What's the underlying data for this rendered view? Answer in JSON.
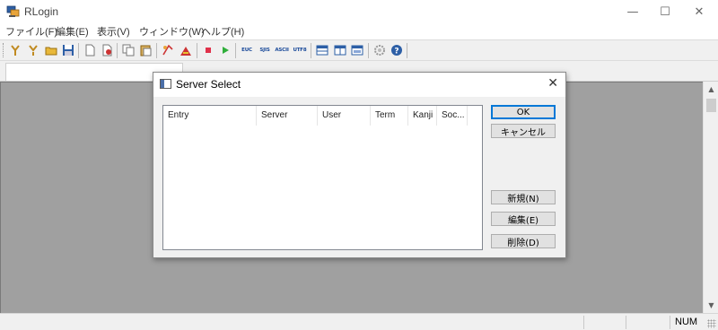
{
  "app": {
    "title": "RLogin"
  },
  "window_controls": {
    "minimize": "—",
    "maximize": "☐",
    "close": "✕"
  },
  "menu": [
    {
      "label": "ファイル(F)"
    },
    {
      "label": "編集(E)"
    },
    {
      "label": "表示(V)"
    },
    {
      "label": "ウィンドウ(W)"
    },
    {
      "label": "ヘルプ(H)"
    }
  ],
  "toolbar": {
    "euc": "EUC",
    "sjis": "SJIS",
    "ascii": "ASCII",
    "utf8": "UTF8"
  },
  "status": {
    "num": "NUM"
  },
  "dialog": {
    "title": "Server Select",
    "close": "✕",
    "columns": [
      "Entry",
      "Server",
      "User",
      "Term",
      "Kanji",
      "Soc..."
    ],
    "buttons": {
      "ok": "OK",
      "cancel": "キャンセル",
      "new": "新規(N)",
      "edit": "編集(E)",
      "delete": "削除(D)"
    }
  },
  "colors": {
    "accent": "#0078d7",
    "client_bg": "#a0a0a0"
  }
}
